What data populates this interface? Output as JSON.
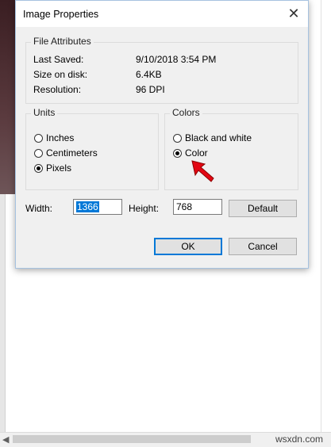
{
  "dialog": {
    "title": "Image Properties",
    "close_label": "✕"
  },
  "file_attributes": {
    "group_title": "File Attributes",
    "rows": [
      {
        "label": "Last Saved:",
        "value": "9/10/2018 3:54 PM"
      },
      {
        "label": "Size on disk:",
        "value": "6.4KB"
      },
      {
        "label": "Resolution:",
        "value": "96 DPI"
      }
    ]
  },
  "units": {
    "group_title": "Units",
    "options": [
      {
        "label": "Inches",
        "checked": false
      },
      {
        "label": "Centimeters",
        "checked": false
      },
      {
        "label": "Pixels",
        "checked": true
      }
    ]
  },
  "colors": {
    "group_title": "Colors",
    "options": [
      {
        "label": "Black and white",
        "checked": false
      },
      {
        "label": "Color",
        "checked": true
      }
    ]
  },
  "size": {
    "width_label": "Width:",
    "width_value": "1366",
    "height_label": "Height:",
    "height_value": "768",
    "default_button": "Default"
  },
  "buttons": {
    "ok": "OK",
    "cancel": "Cancel"
  },
  "watermark": "wsxdn.com",
  "accent_color": "#0078d7",
  "annotation_arrow_color": "#e30613"
}
